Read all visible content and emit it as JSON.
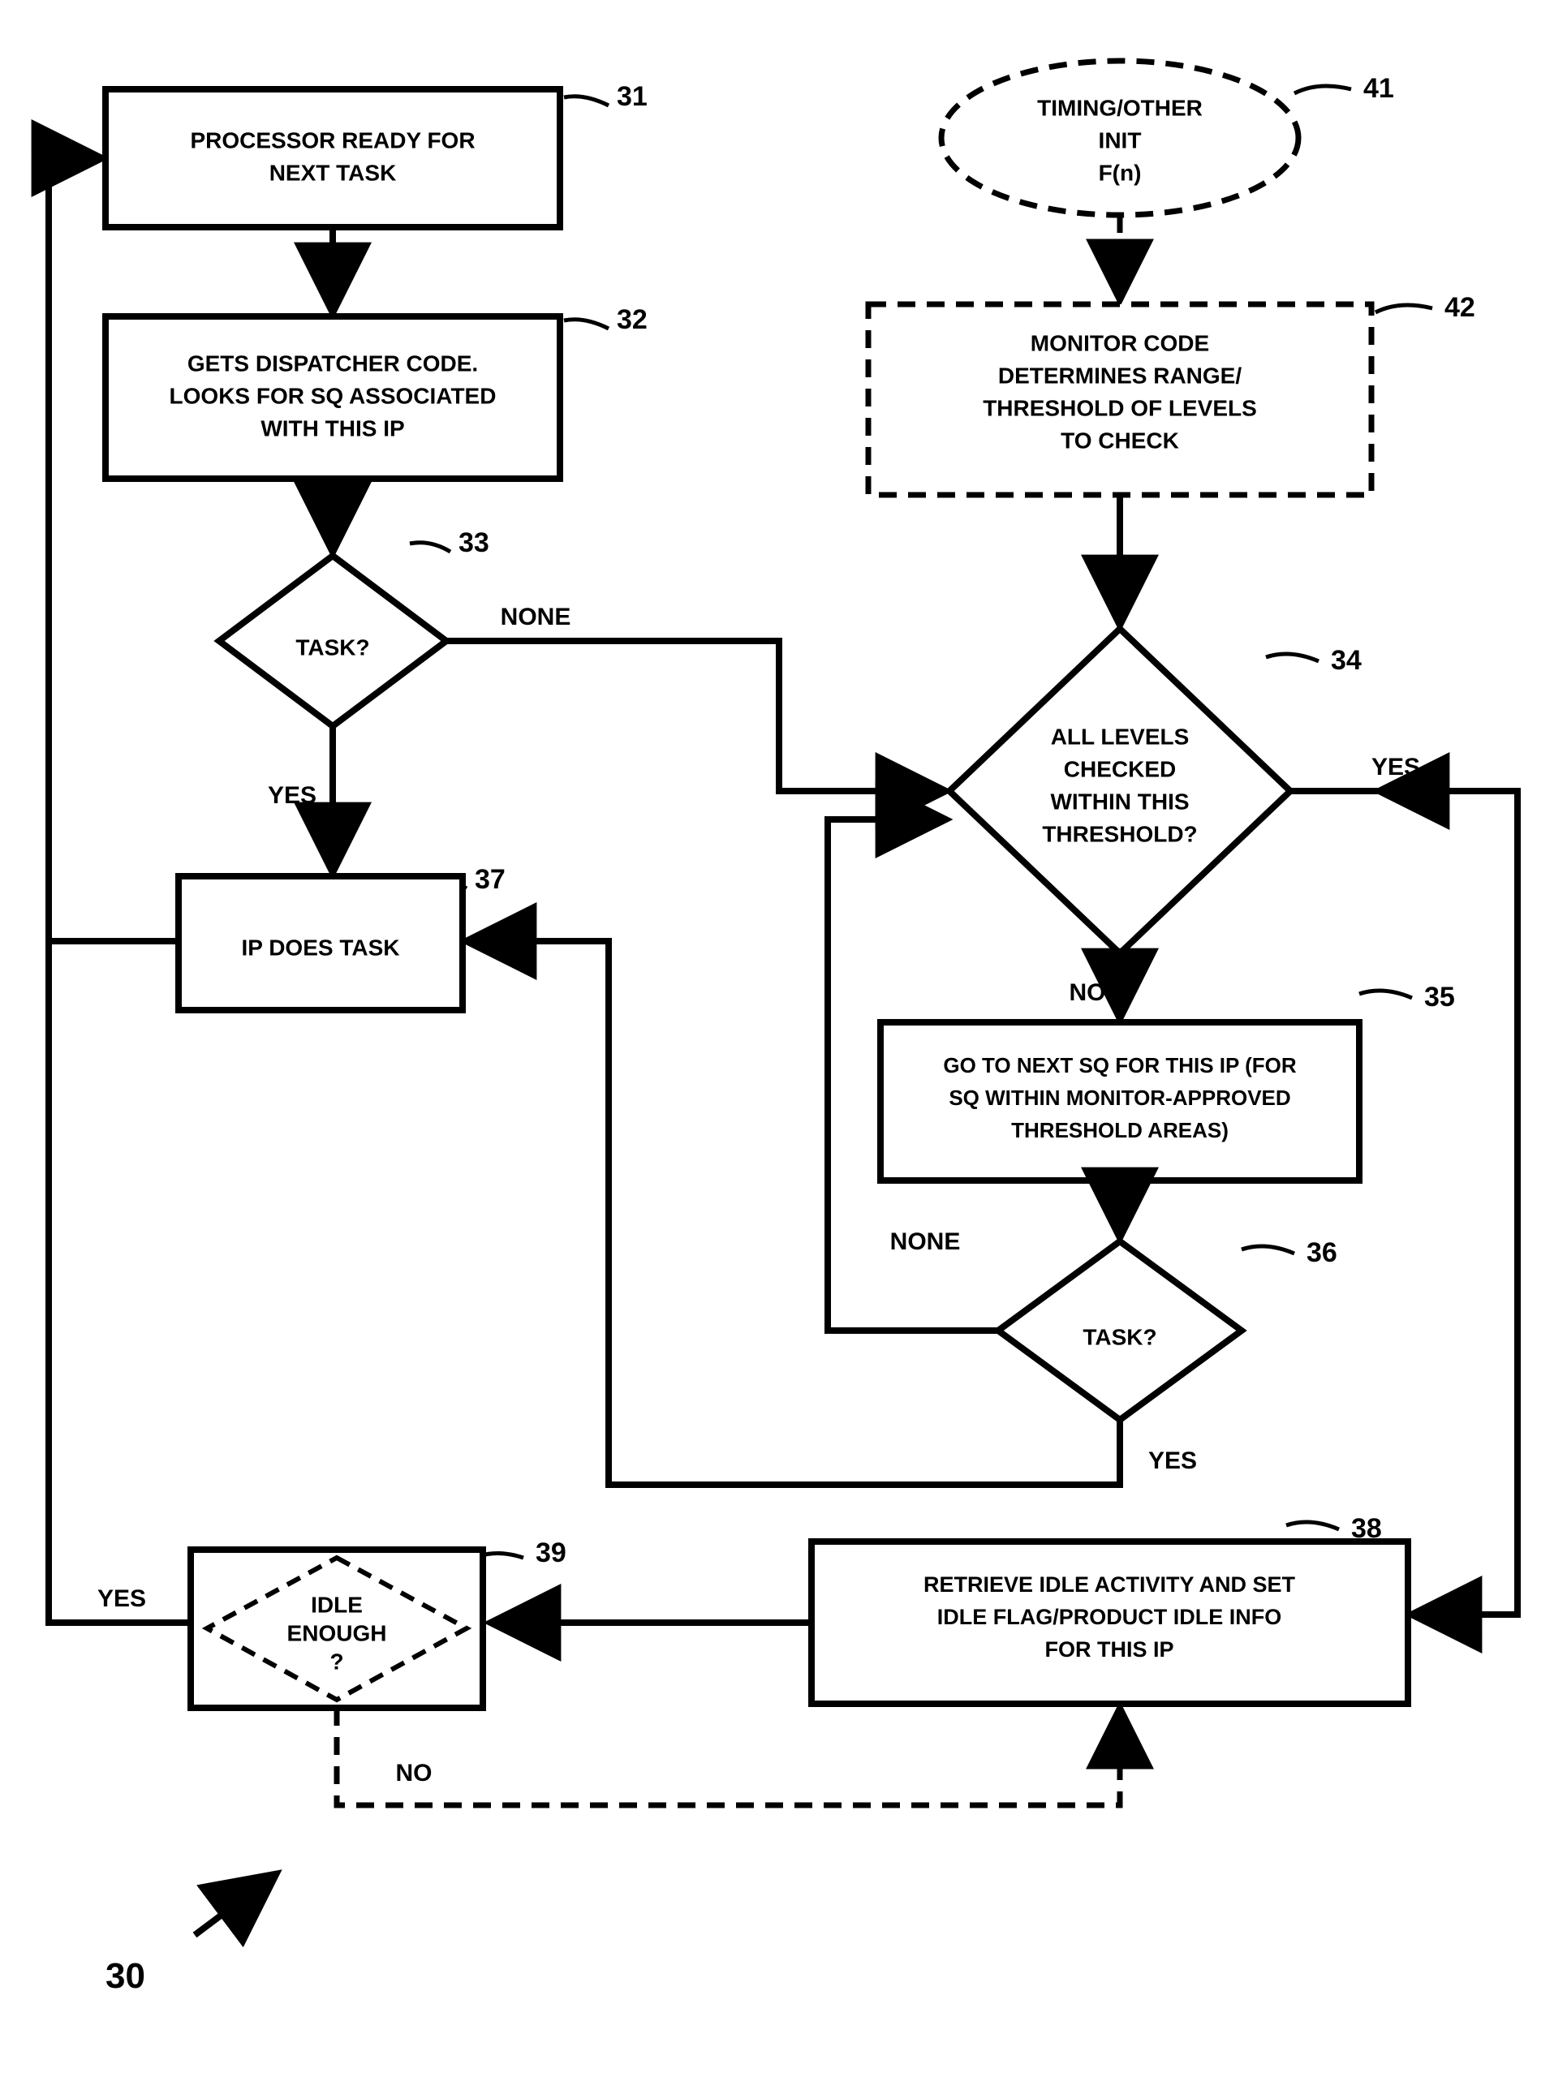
{
  "diagram": {
    "figure_number": "30",
    "nodes": {
      "n31": {
        "label": "31",
        "text": "PROCESSOR READY FOR\nNEXT TASK"
      },
      "n32": {
        "label": "32",
        "text": "GETS DISPATCHER CODE.\nLOOKS FOR SQ ASSOCIATED\nWITH THIS IP"
      },
      "n33": {
        "label": "33",
        "text": "TASK?"
      },
      "n34": {
        "label": "34",
        "text": "ALL LEVELS\nCHECKED\nWITHIN THIS\nTHRESHOLD?"
      },
      "n35": {
        "label": "35",
        "text": "GO TO NEXT SQ FOR THIS IP (FOR\nSQ WITHIN MONITOR-APPROVED\nTHRESHOLD AREAS)"
      },
      "n36": {
        "label": "36",
        "text": "TASK?"
      },
      "n37": {
        "label": "37",
        "text": "IP DOES TASK"
      },
      "n38": {
        "label": "38",
        "text": "RETRIEVE IDLE ACTIVITY AND SET\nIDLE FLAG/PRODUCT IDLE INFO\nFOR THIS IP"
      },
      "n39": {
        "label": "39",
        "text": "IDLE\nENOUGH\n?"
      },
      "n41": {
        "label": "41",
        "text": "TIMING/OTHER\nINIT\nF(n)"
      },
      "n42": {
        "label": "42",
        "text": "MONITOR CODE\nDETERMINES RANGE/\nTHRESHOLD OF LEVELS\nTO CHECK"
      }
    },
    "edges": {
      "yes": "YES",
      "no": "NO",
      "none": "NONE"
    }
  }
}
